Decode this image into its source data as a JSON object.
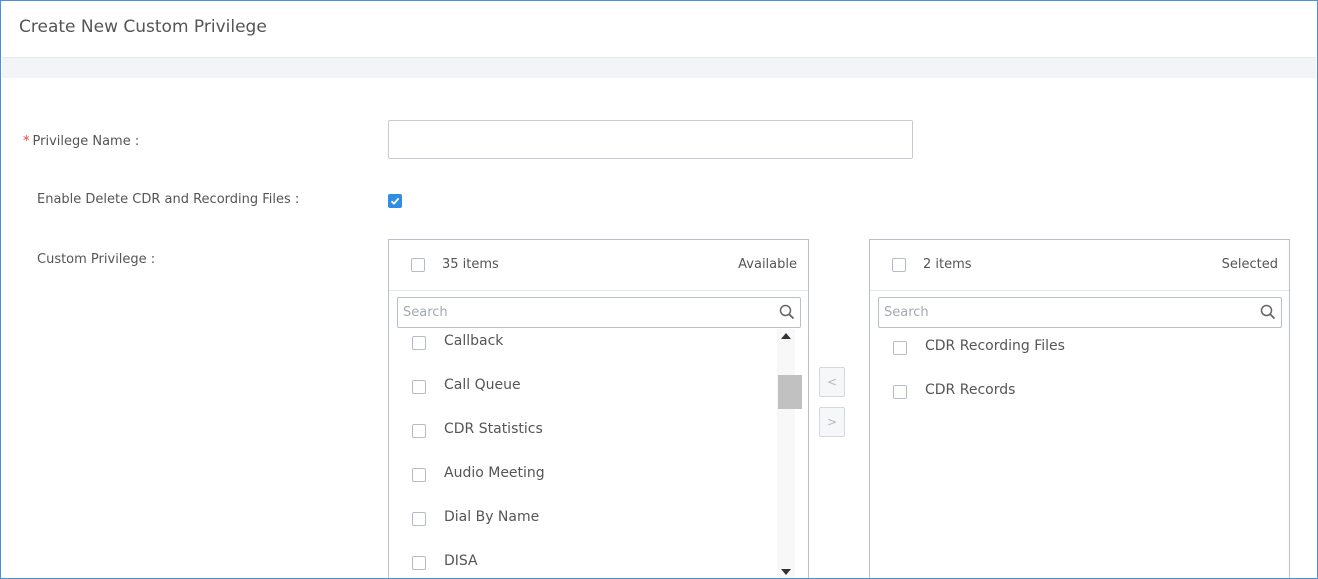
{
  "header": {
    "title": "Create New Custom Privilege"
  },
  "form": {
    "privilege_name": {
      "required_mark": "*",
      "label": "Privilege Name :",
      "value": "",
      "placeholder": ""
    },
    "enable_delete": {
      "label": "Enable Delete CDR and Recording Files :",
      "checked": true
    },
    "custom_privilege": {
      "label": "Custom Privilege :"
    }
  },
  "transfer": {
    "available": {
      "count": "35 items",
      "title": "Available",
      "search_placeholder": "Search",
      "items": [
        "Callback",
        "Call Queue",
        "CDR Statistics",
        "Audio Meeting",
        "Dial By Name",
        "DISA"
      ]
    },
    "selected": {
      "count": "2 items",
      "title": "Selected",
      "search_placeholder": "Search",
      "items": [
        "CDR Recording Files",
        "CDR Records"
      ]
    },
    "move_left_label": "<",
    "move_right_label": ">"
  },
  "colors": {
    "accent": "#2f8de4",
    "frame_border": "#4a90d9",
    "required": "#e0443a"
  }
}
